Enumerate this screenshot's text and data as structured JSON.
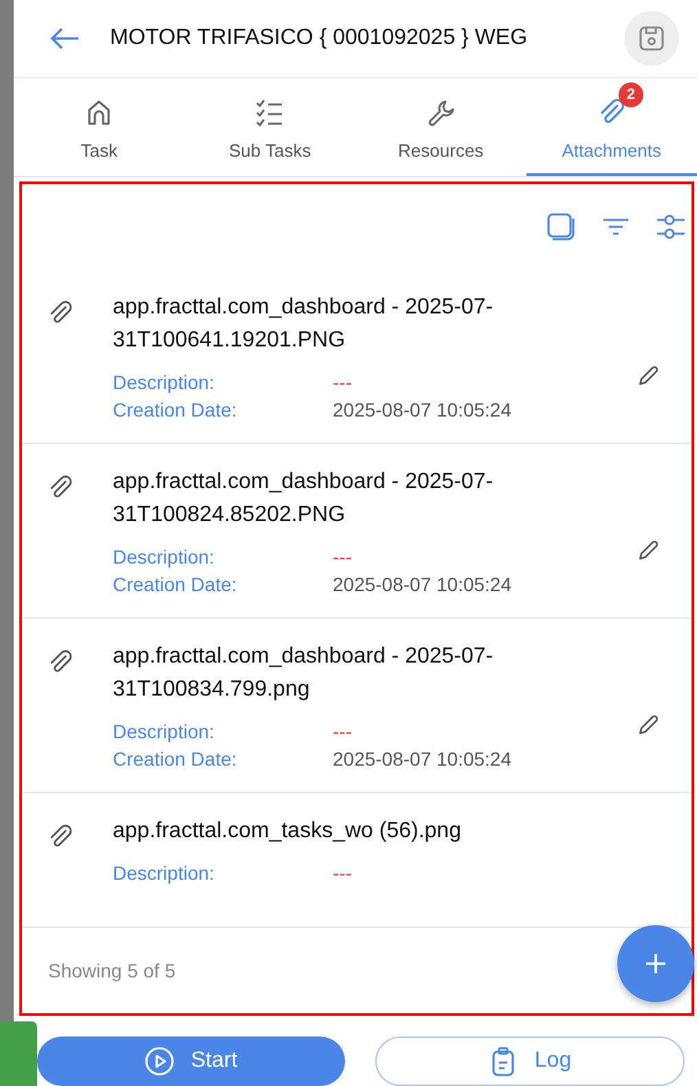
{
  "header": {
    "title": "MOTOR TRIFASICO { 0001092025 } WEG"
  },
  "tabs": [
    {
      "label": "Task",
      "selected": false
    },
    {
      "label": "Sub Tasks",
      "selected": false
    },
    {
      "label": "Resources",
      "selected": false
    },
    {
      "label": "Attachments",
      "selected": true,
      "badge": "2"
    }
  ],
  "attachments": [
    {
      "name": "app.fracttal.com_dashboard - 2025-07-31T100641.19201.PNG",
      "description_label": "Description:",
      "description": "---",
      "date_label": "Creation Date:",
      "creation_date": "2025-08-07 10:05:24"
    },
    {
      "name": "app.fracttal.com_dashboard - 2025-07-31T100824.85202.PNG",
      "description_label": "Description:",
      "description": "---",
      "date_label": "Creation Date:",
      "creation_date": "2025-08-07 10:05:24"
    },
    {
      "name": "app.fracttal.com_dashboard - 2025-07-31T100834.799.png",
      "description_label": "Description:",
      "description": "---",
      "date_label": "Creation Date:",
      "creation_date": "2025-08-07 10:05:24"
    },
    {
      "name": "app.fracttal.com_tasks_wo (56).png",
      "description_label": "Description:",
      "description": "---"
    }
  ],
  "footer": {
    "count": "Showing 5 of 5"
  },
  "actions": [
    {
      "label": "Start",
      "kind": "primary"
    },
    {
      "label": "Log",
      "kind": "outline"
    }
  ]
}
